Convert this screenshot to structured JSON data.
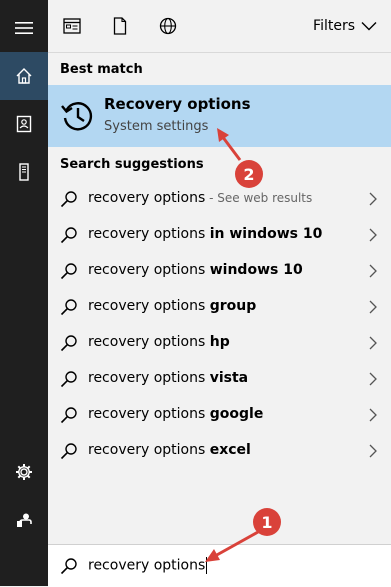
{
  "sidebar": {
    "items": [
      {
        "icon": "hamburger-icon"
      },
      {
        "icon": "home-icon"
      },
      {
        "icon": "notebook-icon"
      },
      {
        "icon": "tower-pc-icon"
      },
      {
        "icon": "gear-icon"
      },
      {
        "icon": "feedback-icon"
      }
    ],
    "active_color": "#2d4a63",
    "bg_color": "#1f1f1f"
  },
  "topbar": {
    "filters_label": "Filters",
    "icons": [
      "apps-icon",
      "document-icon",
      "globe-icon"
    ]
  },
  "best_match": {
    "heading": "Best match",
    "title": "Recovery options",
    "subtitle": "System settings",
    "icon": "history-icon",
    "highlight_color": "#b3d7f2"
  },
  "suggestions": {
    "heading": "Search suggestions",
    "items": [
      {
        "prefix": "recovery options",
        "bold": "",
        "web": " - See web results"
      },
      {
        "prefix": "recovery options ",
        "bold": "in windows 10",
        "web": ""
      },
      {
        "prefix": "recovery options ",
        "bold": "windows 10",
        "web": ""
      },
      {
        "prefix": "recovery options ",
        "bold": "group",
        "web": ""
      },
      {
        "prefix": "recovery options ",
        "bold": "hp",
        "web": ""
      },
      {
        "prefix": "recovery options ",
        "bold": "vista",
        "web": ""
      },
      {
        "prefix": "recovery options ",
        "bold": "google",
        "web": ""
      },
      {
        "prefix": "recovery options ",
        "bold": "excel",
        "web": ""
      }
    ]
  },
  "search": {
    "value": "recovery options"
  },
  "annotations": [
    {
      "number": "1"
    },
    {
      "number": "2"
    }
  ],
  "annotation_color": "#d9423a"
}
